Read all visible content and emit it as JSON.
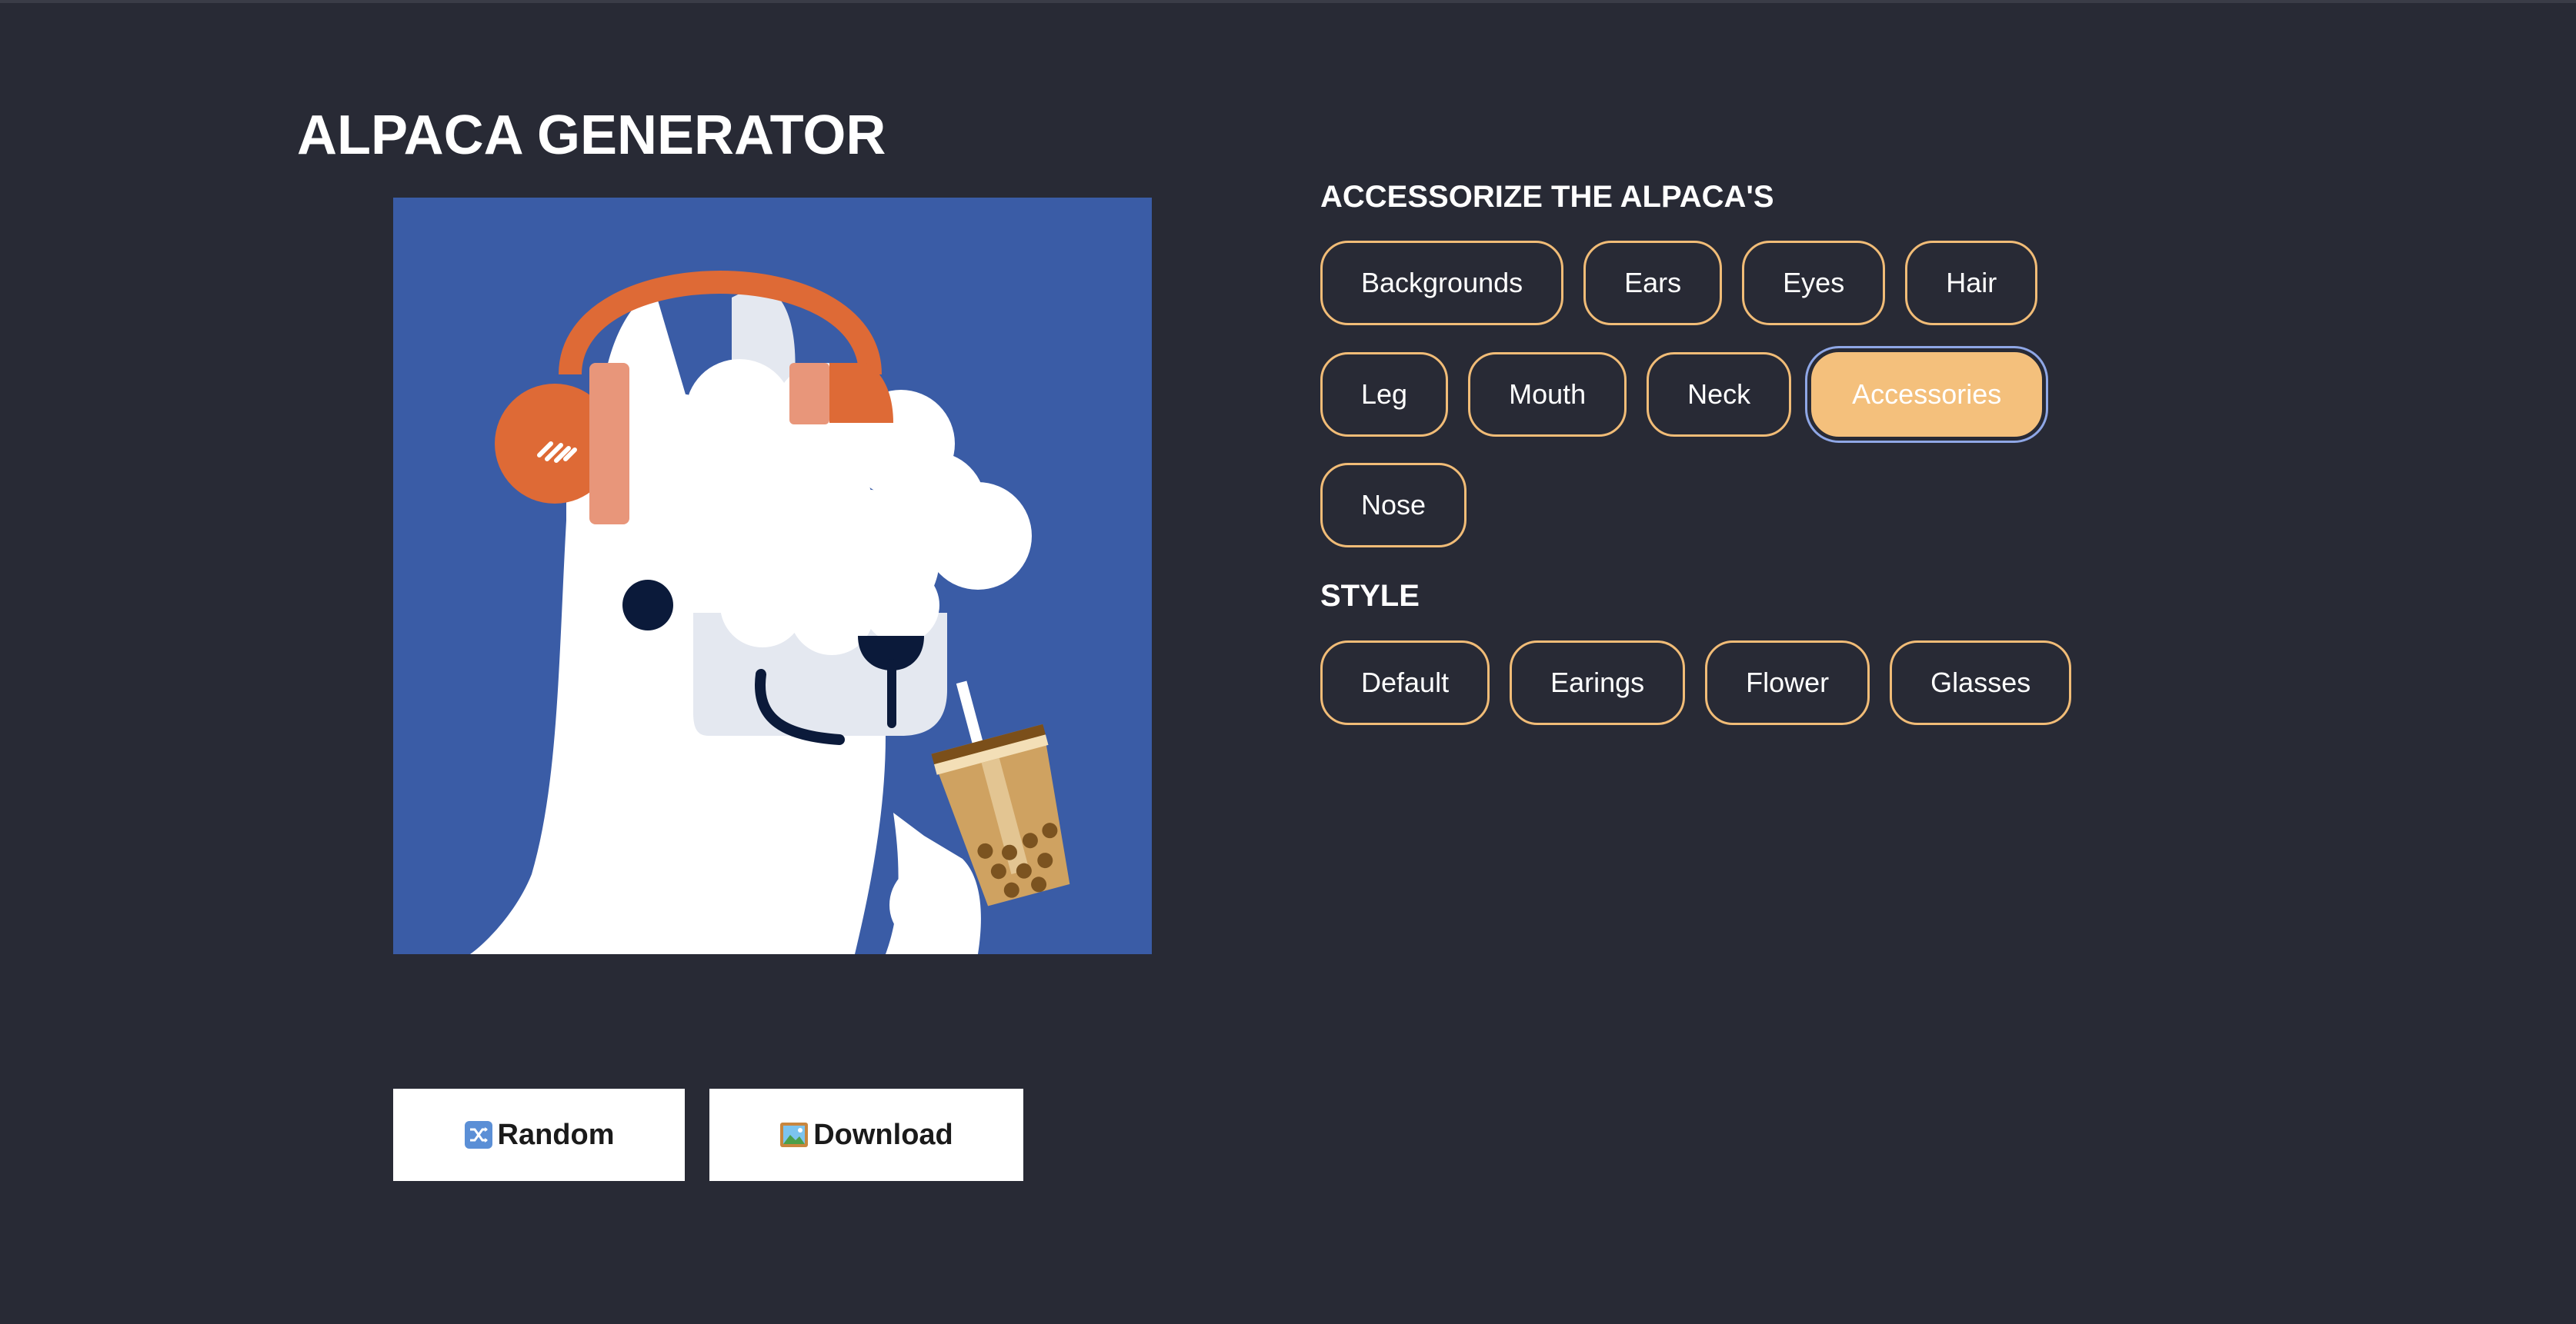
{
  "app": {
    "title": "ALPACA GENERATOR"
  },
  "preview": {
    "background_color": "#3a5ca6",
    "layers": {
      "accessory": "headphones",
      "item": "bubble-tea-cup"
    }
  },
  "actions": {
    "random_label": "Random",
    "random_icon": "shuffle-icon",
    "download_label": "Download",
    "download_icon": "picture-icon"
  },
  "accessorize": {
    "title": "ACCESSORIZE THE ALPACA'S",
    "active_index": 7,
    "items": [
      {
        "label": "Backgrounds"
      },
      {
        "label": "Ears"
      },
      {
        "label": "Eyes"
      },
      {
        "label": "Hair"
      },
      {
        "label": "Leg"
      },
      {
        "label": "Mouth"
      },
      {
        "label": "Neck"
      },
      {
        "label": "Accessories"
      },
      {
        "label": "Nose"
      }
    ]
  },
  "style": {
    "title": "STYLE",
    "items": [
      {
        "label": "Default"
      },
      {
        "label": "Earings"
      },
      {
        "label": "Flower"
      },
      {
        "label": "Glasses"
      }
    ]
  },
  "colors": {
    "page_bg": "#282a35",
    "accent": "#f1bc77",
    "active_chip": "#f4c07c",
    "focus_ring": "#8fa7e6"
  }
}
